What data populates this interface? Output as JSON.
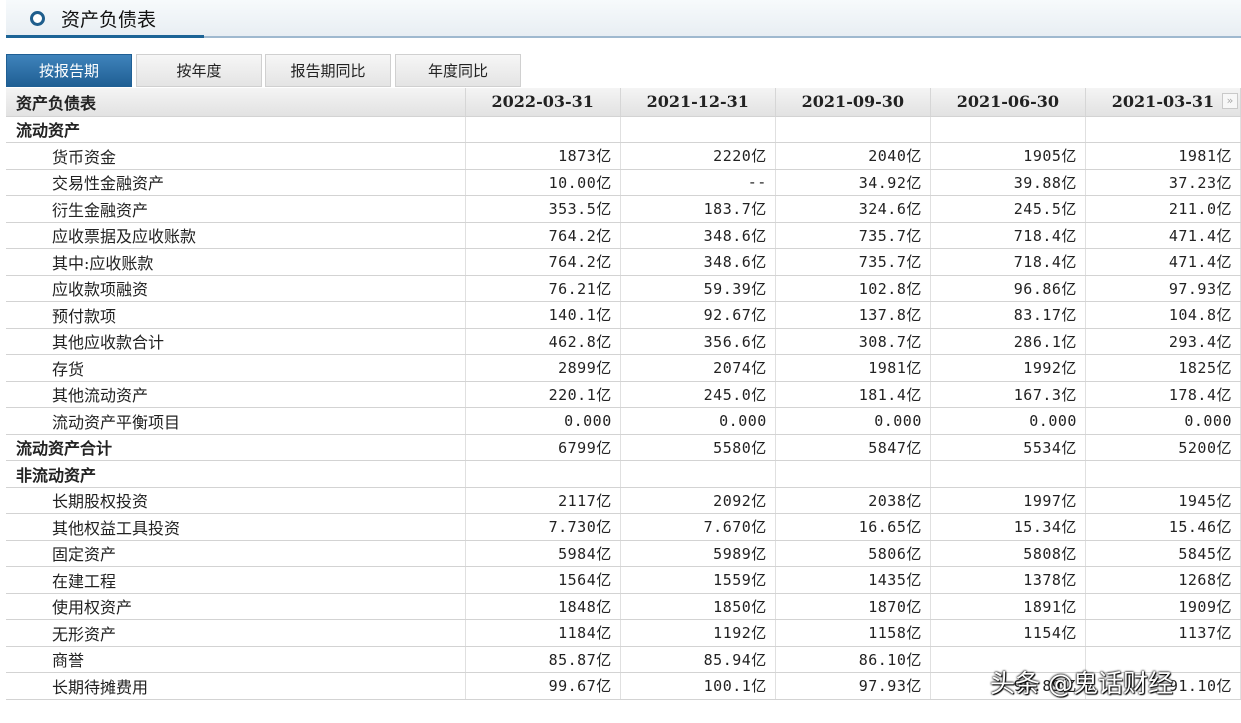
{
  "header": {
    "title": "资产负债表"
  },
  "tabs": [
    {
      "label": "按报告期",
      "active": true
    },
    {
      "label": "按年度",
      "active": false
    },
    {
      "label": "报告期同比",
      "active": false
    },
    {
      "label": "年度同比",
      "active": false
    }
  ],
  "table": {
    "label_header": "资产负债表",
    "columns": [
      "2022-03-31",
      "2021-12-31",
      "2021-09-30",
      "2021-06-30",
      "2021-03-31"
    ],
    "rows": [
      {
        "type": "section",
        "name": "流动资产",
        "values": [
          "",
          "",
          "",
          "",
          ""
        ]
      },
      {
        "type": "item",
        "name": "货币资金",
        "values": [
          "1873亿",
          "2220亿",
          "2040亿",
          "1905亿",
          "1981亿"
        ]
      },
      {
        "type": "item",
        "name": "交易性金融资产",
        "values": [
          "10.00亿",
          "--",
          "34.92亿",
          "39.88亿",
          "37.23亿"
        ]
      },
      {
        "type": "item",
        "name": "衍生金融资产",
        "values": [
          "353.5亿",
          "183.7亿",
          "324.6亿",
          "245.5亿",
          "211.0亿"
        ]
      },
      {
        "type": "item",
        "name": "应收票据及应收账款",
        "values": [
          "764.2亿",
          "348.6亿",
          "735.7亿",
          "718.4亿",
          "471.4亿"
        ]
      },
      {
        "type": "item",
        "name": "其中:应收账款",
        "values": [
          "764.2亿",
          "348.6亿",
          "735.7亿",
          "718.4亿",
          "471.4亿"
        ]
      },
      {
        "type": "item",
        "name": "应收款项融资",
        "values": [
          "76.21亿",
          "59.39亿",
          "102.8亿",
          "96.86亿",
          "97.93亿"
        ]
      },
      {
        "type": "item",
        "name": "预付款项",
        "values": [
          "140.1亿",
          "92.67亿",
          "137.8亿",
          "83.17亿",
          "104.8亿"
        ]
      },
      {
        "type": "item",
        "name": "其他应收款合计",
        "values": [
          "462.8亿",
          "356.6亿",
          "308.7亿",
          "286.1亿",
          "293.4亿"
        ]
      },
      {
        "type": "item",
        "name": "存货",
        "values": [
          "2899亿",
          "2074亿",
          "1981亿",
          "1992亿",
          "1825亿"
        ]
      },
      {
        "type": "item",
        "name": "其他流动资产",
        "values": [
          "220.1亿",
          "245.0亿",
          "181.4亿",
          "167.3亿",
          "178.4亿"
        ]
      },
      {
        "type": "item",
        "name": "流动资产平衡项目",
        "values": [
          "0.000",
          "0.000",
          "0.000",
          "0.000",
          "0.000"
        ]
      },
      {
        "type": "total",
        "name": "流动资产合计",
        "values": [
          "6799亿",
          "5580亿",
          "5847亿",
          "5534亿",
          "5200亿"
        ]
      },
      {
        "type": "section",
        "name": "非流动资产",
        "values": [
          "",
          "",
          "",
          "",
          ""
        ]
      },
      {
        "type": "item",
        "name": "长期股权投资",
        "values": [
          "2117亿",
          "2092亿",
          "2038亿",
          "1997亿",
          "1945亿"
        ]
      },
      {
        "type": "item",
        "name": "其他权益工具投资",
        "values": [
          "7.730亿",
          "7.670亿",
          "16.65亿",
          "15.34亿",
          "15.46亿"
        ]
      },
      {
        "type": "item",
        "name": "固定资产",
        "values": [
          "5984亿",
          "5989亿",
          "5806亿",
          "5808亿",
          "5845亿"
        ]
      },
      {
        "type": "item",
        "name": "在建工程",
        "values": [
          "1564亿",
          "1559亿",
          "1435亿",
          "1378亿",
          "1268亿"
        ]
      },
      {
        "type": "item",
        "name": "使用权资产",
        "values": [
          "1848亿",
          "1850亿",
          "1870亿",
          "1891亿",
          "1909亿"
        ]
      },
      {
        "type": "item",
        "name": "无形资产",
        "values": [
          "1184亿",
          "1192亿",
          "1158亿",
          "1154亿",
          "1137亿"
        ]
      },
      {
        "type": "item",
        "name": "商誉",
        "values": [
          "85.87亿",
          "85.94亿",
          "86.10亿",
          "",
          ""
        ]
      },
      {
        "type": "item",
        "name": "长期待摊费用",
        "values": [
          "99.67亿",
          "100.1亿",
          "97.93亿",
          "96.89亿",
          "91.10亿"
        ]
      }
    ]
  },
  "watermark": {
    "text": "头条 @鬼话财经"
  }
}
